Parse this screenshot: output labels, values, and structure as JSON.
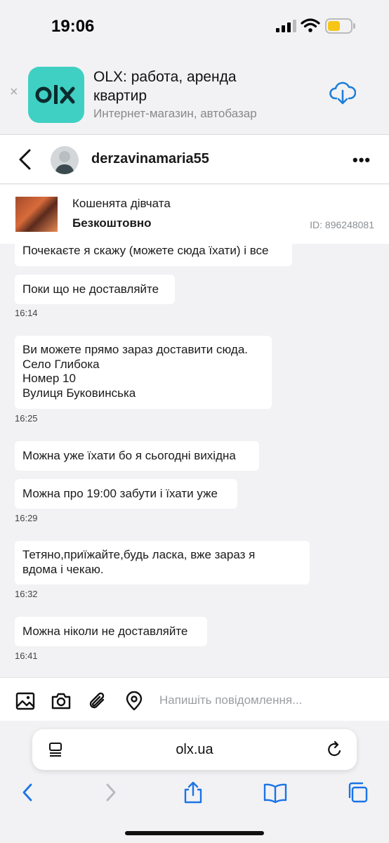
{
  "status_bar": {
    "time": "19:06",
    "battery_color": "#f5c518"
  },
  "app_banner": {
    "close_label": "×",
    "logo_text": "OLX",
    "title": "OLX: работа, аренда квартир",
    "subtitle": "Интернет-магазин, автобазар",
    "icon_color": "#3fd0c3",
    "action_color": "#1e7fd8"
  },
  "chat": {
    "username": "derzavinamaria55",
    "more_label": "•••"
  },
  "ad": {
    "title": "Кошенята дівчата",
    "price": "Безкоштовно",
    "id": "ID: 896248081"
  },
  "messages": [
    {
      "text": "Почекаєте я скажу (можете сюда їхати) і все"
    },
    {
      "text": "Поки що не доставляйте",
      "time": "16:14"
    },
    {
      "lines": [
        "Ви можете прямо зараз доставити сюда.",
        "Село Глибока",
        "Номер 10",
        "Вулиця Буковинська"
      ],
      "time": "16:25"
    },
    {
      "text": "Можна уже їхати бо я сьогодні вихідна"
    },
    {
      "text": "Можна про 19:00 забути і їхати уже",
      "time": "16:29"
    },
    {
      "lines": [
        "Тетяно,приїжайте,будь ласка, вже зараз я",
        "вдома і чекаю."
      ],
      "time": "16:32"
    },
    {
      "text": "Можна ніколи не доставляйте",
      "time": "16:41"
    }
  ],
  "composer": {
    "placeholder": "Напишіть повідомлення..."
  },
  "browser": {
    "url": "olx.ua",
    "accent": "#1a73e8"
  }
}
